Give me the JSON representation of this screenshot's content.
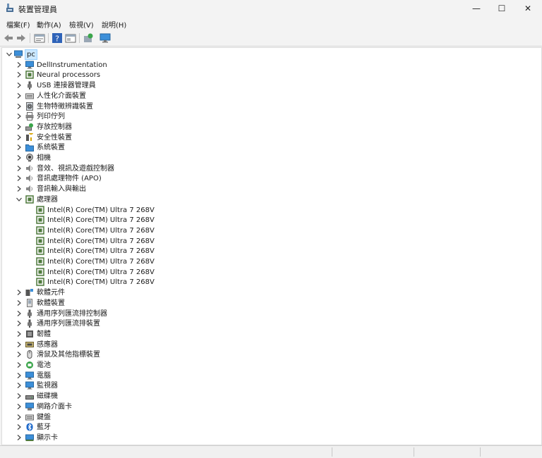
{
  "window": {
    "title": "裝置管理員",
    "buttons": {
      "minimize": "—",
      "maximize": "☐",
      "close": "✕"
    }
  },
  "menu": [
    "檔案(F)",
    "動作(A)",
    "檢視(V)",
    "說明(H)"
  ],
  "toolbar": [
    "back-icon",
    "forward-icon",
    "properties-view-icon",
    "help-icon",
    "show-hidden-icon",
    "scan-hardware-icon",
    "monitor-icon"
  ],
  "tree": {
    "root": {
      "label": "pc",
      "icon": "computer-icon"
    },
    "items": [
      {
        "label": "DellInstrumentation",
        "icon": "monitor-icon",
        "expanded": false
      },
      {
        "label": "Neural processors",
        "icon": "chip-icon",
        "expanded": false
      },
      {
        "label": "USB 連接器管理員",
        "icon": "usb-icon",
        "expanded": false
      },
      {
        "label": "人性化介面裝置",
        "icon": "keyboard-icon",
        "expanded": false
      },
      {
        "label": "生物特徵辨識裝置",
        "icon": "fingerprint-icon",
        "expanded": false
      },
      {
        "label": "列印佇列",
        "icon": "printer-icon",
        "expanded": false
      },
      {
        "label": "存放控制器",
        "icon": "storage-icon",
        "expanded": false
      },
      {
        "label": "安全性裝置",
        "icon": "security-icon",
        "expanded": false
      },
      {
        "label": "系統裝置",
        "icon": "folder-icon",
        "expanded": false
      },
      {
        "label": "相機",
        "icon": "camera-icon",
        "expanded": false
      },
      {
        "label": "音效、視訊及遊戲控制器",
        "icon": "speaker-icon",
        "expanded": false
      },
      {
        "label": "音訊處理物件 (APO)",
        "icon": "speaker-icon",
        "expanded": false
      },
      {
        "label": "音訊輸入與輸出",
        "icon": "speaker-icon",
        "expanded": false
      },
      {
        "label": "處理器",
        "icon": "chip-icon",
        "expanded": true,
        "children": [
          "Intel(R) Core(TM) Ultra 7 268V",
          "Intel(R) Core(TM) Ultra 7 268V",
          "Intel(R) Core(TM) Ultra 7 268V",
          "Intel(R) Core(TM) Ultra 7 268V",
          "Intel(R) Core(TM) Ultra 7 268V",
          "Intel(R) Core(TM) Ultra 7 268V",
          "Intel(R) Core(TM) Ultra 7 268V",
          "Intel(R) Core(TM) Ultra 7 268V"
        ]
      },
      {
        "label": "軟體元件",
        "icon": "software-component-icon",
        "expanded": false
      },
      {
        "label": "軟體裝置",
        "icon": "software-device-icon",
        "expanded": false
      },
      {
        "label": "通用序列匯流排控制器",
        "icon": "usb-icon",
        "expanded": false
      },
      {
        "label": "通用序列匯流排裝置",
        "icon": "usb-icon",
        "expanded": false
      },
      {
        "label": "韌體",
        "icon": "firmware-icon",
        "expanded": false
      },
      {
        "label": "感應器",
        "icon": "sensor-icon",
        "expanded": false
      },
      {
        "label": "滑鼠及其他指標裝置",
        "icon": "mouse-icon",
        "expanded": false
      },
      {
        "label": "電池",
        "icon": "battery-icon",
        "expanded": false
      },
      {
        "label": "電腦",
        "icon": "monitor-icon",
        "expanded": false
      },
      {
        "label": "監視器",
        "icon": "monitor-icon",
        "expanded": false
      },
      {
        "label": "磁碟機",
        "icon": "disk-icon",
        "expanded": false
      },
      {
        "label": "網路介面卡",
        "icon": "network-icon",
        "expanded": false
      },
      {
        "label": "鍵盤",
        "icon": "keyboard-icon",
        "expanded": false
      },
      {
        "label": "藍牙",
        "icon": "bluetooth-icon",
        "expanded": false
      },
      {
        "label": "顯示卡",
        "icon": "display-adapter-icon",
        "expanded": false
      }
    ]
  },
  "colors": {
    "selection": "#cce8ff",
    "tree_bg": "#ffffff",
    "chrome": "#f3f3f3",
    "icon_blue": "#2d7fd3",
    "chip_green": "#4e7a3c"
  }
}
